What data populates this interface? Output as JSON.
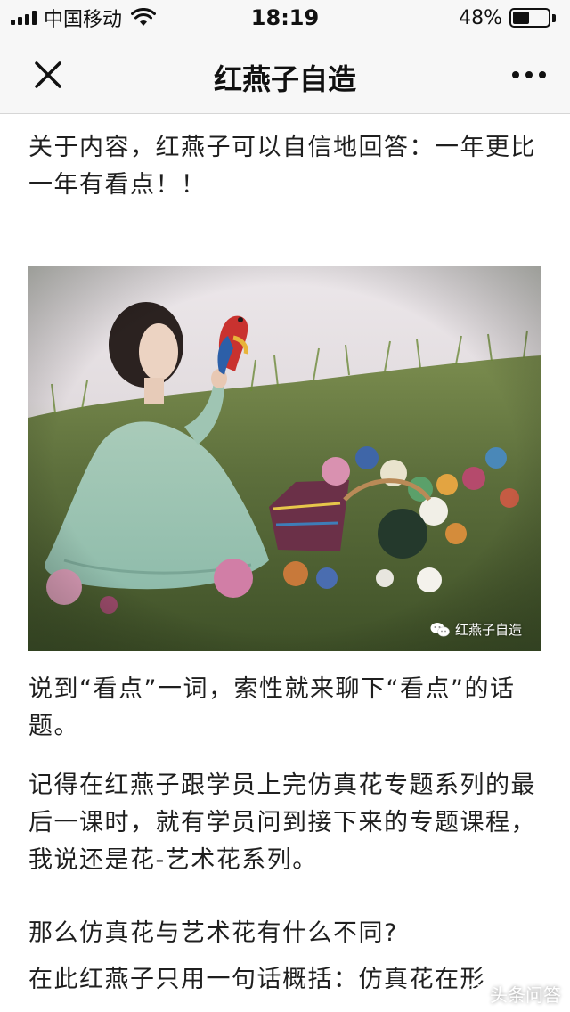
{
  "status_bar": {
    "carrier": "中国移动",
    "time": "18:19",
    "battery_percent_label": "48%",
    "battery_level": 0.48,
    "icons": [
      "signal-icon",
      "wifi-icon",
      "battery-icon"
    ]
  },
  "nav": {
    "title": "红燕子自造",
    "close_icon": "close-icon",
    "more_icon": "more-icon"
  },
  "article": {
    "intro": "关于内容，红燕子可以自信地回答：一年更比一年有看点！！",
    "image": {
      "watermark": "红燕子自造",
      "watermark_icon": "wechat-icon"
    },
    "paragraphs": [
      "说到“看点”一词，索性就来聊下“看点”的话题。",
      "记得在红燕子跟学员上完仿真花专题系列的最后一课时，就有学员问到接下来的专题课程，我说还是花-艺术花系列。",
      "那么仿真花与艺术花有什么不同?",
      "在此红燕子只用一句话概括：仿真花在形"
    ]
  },
  "site_badge": {
    "label": "头条问答",
    "icon": "toutiao-icon"
  },
  "colors": {
    "bar_background": "#f7f7f7",
    "text": "#1f1f1f",
    "divider": "#d6d6d6"
  }
}
